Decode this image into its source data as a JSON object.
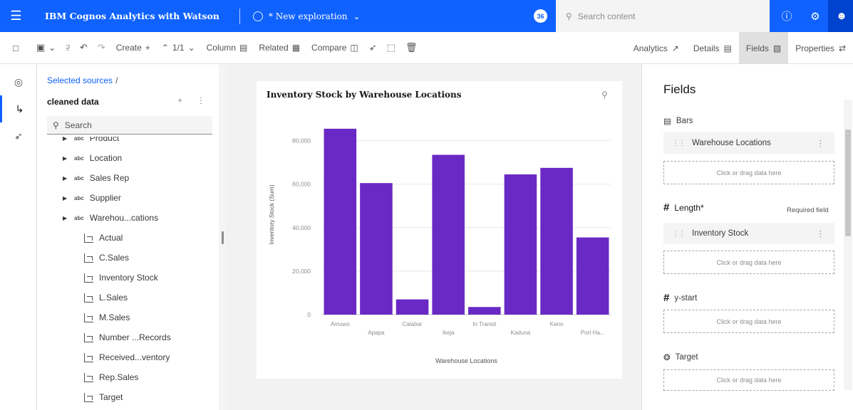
{
  "topbar": {
    "brand": "IBM Cognos Analytics with Watson",
    "exploration": "* New exploration",
    "badge": "36",
    "search_placeholder": "Search content"
  },
  "toolbar": {
    "create": "Create",
    "pages": "1/1",
    "column": "Column",
    "related": "Related",
    "compare": "Compare",
    "tabs": [
      "Analytics",
      "Details",
      "Fields",
      "Properties"
    ]
  },
  "sources": {
    "crumb": "Selected sources",
    "crumb_sep": "/",
    "dataset": "cleaned data",
    "search_placeholder": "Search",
    "items": [
      {
        "label": "Product",
        "kind": "attr"
      },
      {
        "label": "Location",
        "kind": "attr"
      },
      {
        "label": "Sales Rep",
        "kind": "attr"
      },
      {
        "label": "Supplier",
        "kind": "attr"
      },
      {
        "label": "Warehou...cations",
        "kind": "attr"
      },
      {
        "label": "Actual",
        "kind": "measure"
      },
      {
        "label": "C.Sales",
        "kind": "measure"
      },
      {
        "label": "Inventory Stock",
        "kind": "measure"
      },
      {
        "label": "L.Sales",
        "kind": "measure"
      },
      {
        "label": "M.Sales",
        "kind": "measure"
      },
      {
        "label": "Number ...Records",
        "kind": "measure"
      },
      {
        "label": "Received...ventory",
        "kind": "measure"
      },
      {
        "label": "Rep.Sales",
        "kind": "measure"
      },
      {
        "label": "Target",
        "kind": "measure"
      }
    ]
  },
  "chart_data": {
    "type": "bar",
    "title": "Inventory Stock by Warehouse Locations",
    "xlabel": "Warehouse Locations",
    "ylabel": "Inventory Stock (Sum)",
    "categories": [
      "Amuwo",
      "Apapa",
      "Calabar",
      "Ikeja",
      "In Transit",
      "Kaduna",
      "Kano",
      "Port Ha..."
    ],
    "values": [
      85500,
      60500,
      7000,
      73500,
      3500,
      64500,
      67500,
      35500
    ],
    "yticks": [
      0,
      20000,
      40000,
      60000,
      80000
    ],
    "ytick_labels": [
      "0",
      "20,000",
      "40,000",
      "60,000",
      "80,000"
    ],
    "ylim": [
      0,
      92000
    ],
    "grid": true,
    "bar_color": "#6929c4"
  },
  "fields": {
    "title": "Fields",
    "bars_label": "Bars",
    "bars_chip": "Warehouse Locations",
    "drop_text": "Click or drag data here",
    "length_label": "Length*",
    "required": "Required field",
    "length_chip": "Inventory Stock",
    "ystart_label": "y-start",
    "target_label": "Target"
  },
  "colors": {
    "accent": "#0f62fe",
    "bar": "#6929c4"
  }
}
